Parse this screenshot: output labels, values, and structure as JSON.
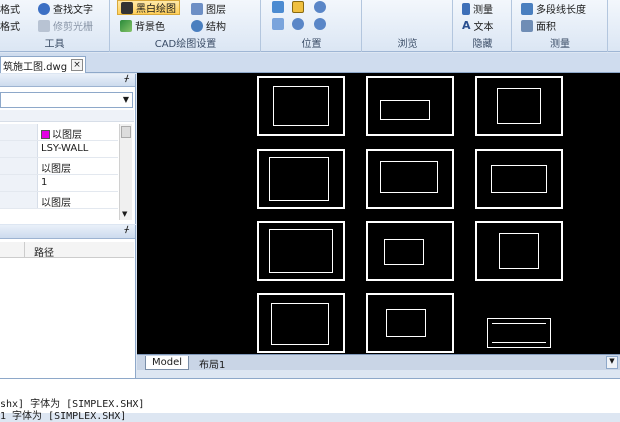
{
  "ribbon": {
    "groups": {
      "tools": {
        "label": "工具",
        "items": [
          "格式",
          "格式",
          "查找文字",
          "修剪光栅"
        ]
      },
      "cad_settings": {
        "label": "CAD绘图设置",
        "items": [
          "黑白绘图",
          "背景色",
          "图层",
          "结构"
        ]
      },
      "position": {
        "label": "位置"
      },
      "browse": {
        "label": "浏览"
      },
      "hide": {
        "label": "隐藏",
        "items": [
          "测量",
          "文本"
        ]
      },
      "measure": {
        "label": "测量",
        "items": [
          "多段线长度",
          "面积"
        ]
      }
    }
  },
  "document_tab": {
    "title": "筑施工图.dwg",
    "close": "×"
  },
  "properties_panel": {
    "pin": "ᚋ",
    "rows": [
      {
        "value": "以图层",
        "swatch": "#e400e4"
      },
      {
        "value": "LSY-WALL"
      },
      {
        "value": "以图层"
      },
      {
        "value": "1"
      },
      {
        "value": "以图层"
      }
    ]
  },
  "files_panel": {
    "pin": "ᚋ",
    "column_path": "路径"
  },
  "layout_tabs": {
    "model": "Model",
    "layout1": "布局1"
  },
  "command_lines": [
    "shx] 字体为 [SIMPLEX.SHX]",
    "1 字体为 [SIMPLEX.SHX]"
  ]
}
